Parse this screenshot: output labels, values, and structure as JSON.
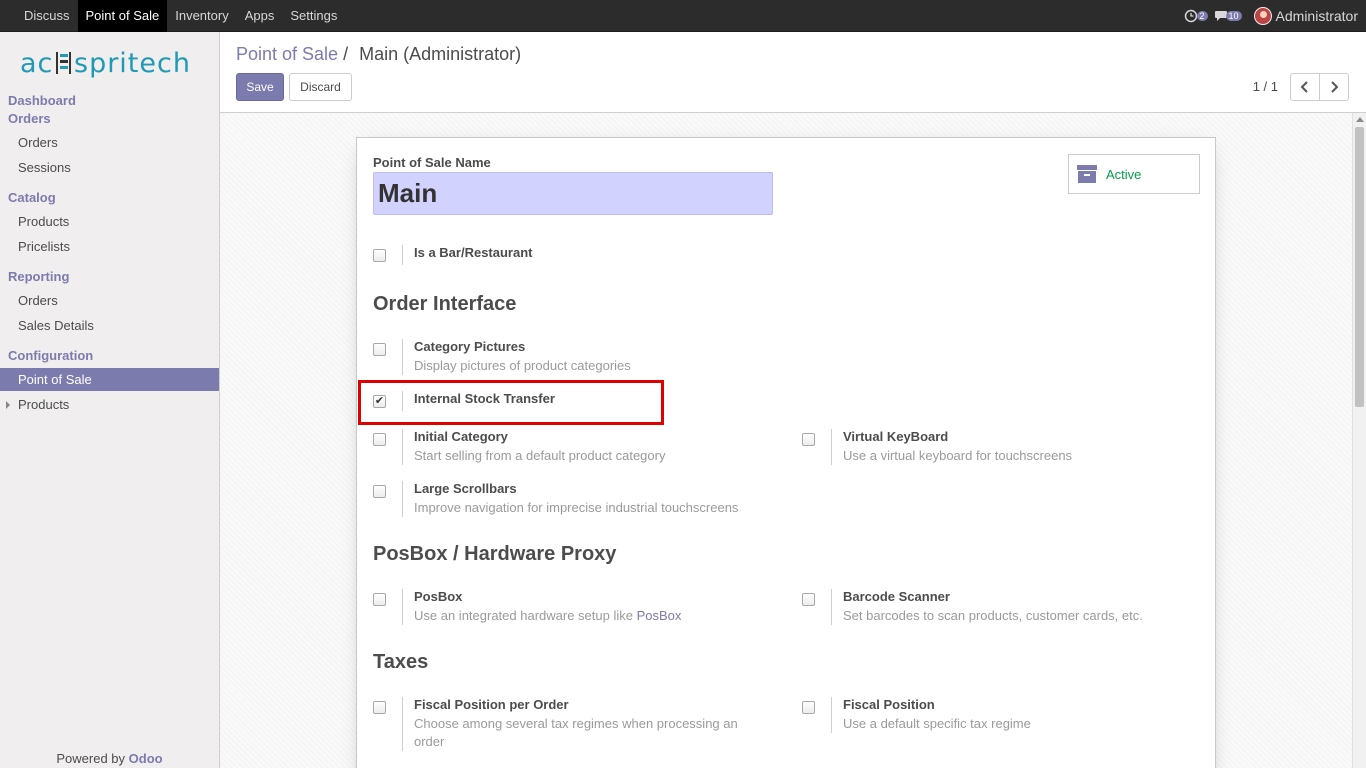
{
  "topbar": {
    "menu": [
      "Discuss",
      "Point of Sale",
      "Inventory",
      "Apps",
      "Settings"
    ],
    "active_index": 1,
    "activity_count": "2",
    "messages_count": "10",
    "user_name": "Administrator"
  },
  "sidebar": {
    "logo_text": "acespritech",
    "dashboard": "Dashboard",
    "orders_head": "Orders",
    "orders_items": [
      "Orders",
      "Sessions"
    ],
    "catalog_head": "Catalog",
    "catalog_items": [
      "Products",
      "Pricelists"
    ],
    "reporting_head": "Reporting",
    "reporting_items": [
      "Orders",
      "Sales Details"
    ],
    "configuration_head": "Configuration",
    "configuration_items": [
      "Point of Sale",
      "Products"
    ],
    "powered_by": "Powered by",
    "powered_brand": "Odoo"
  },
  "control_panel": {
    "breadcrumb_parent": "Point of Sale",
    "breadcrumb_sep": "/",
    "breadcrumb_current": "Main (Administrator)",
    "save_label": "Save",
    "discard_label": "Discard",
    "pager": "1 / 1"
  },
  "form": {
    "name_label": "Point of Sale Name",
    "name_value": "Main",
    "active_label": "Active",
    "bar_restaurant": "Is a Bar/Restaurant",
    "section_order_interface": "Order Interface",
    "category_pictures_title": "Category Pictures",
    "category_pictures_desc": "Display pictures of product categories",
    "internal_stock_title": "Internal Stock Transfer",
    "initial_category_title": "Initial Category",
    "initial_category_desc": "Start selling from a default product category",
    "virtual_keyboard_title": "Virtual KeyBoard",
    "virtual_keyboard_desc": "Use a virtual keyboard for touchscreens",
    "large_scrollbars_title": "Large Scrollbars",
    "large_scrollbars_desc": "Improve navigation for imprecise industrial touchscreens",
    "section_posbox": "PosBox / Hardware Proxy",
    "posbox_title": "PosBox",
    "posbox_desc": "Use an integrated hardware setup like",
    "posbox_link": "PosBox",
    "barcode_title": "Barcode Scanner",
    "barcode_desc": "Set barcodes to scan products, customer cards, etc.",
    "section_taxes": "Taxes",
    "fiscal_per_order_title": "Fiscal Position per Order",
    "fiscal_per_order_desc": "Choose among several tax regimes when processing an order",
    "fiscal_title": "Fiscal Position",
    "fiscal_desc": "Use a default specific tax regime"
  },
  "colors": {
    "accent": "#7c7bad",
    "topbar_bg": "#2c2c2c",
    "highlight_box": "#e00000",
    "active_green": "#00a04a",
    "name_input_bg": "#d2d2ff"
  }
}
